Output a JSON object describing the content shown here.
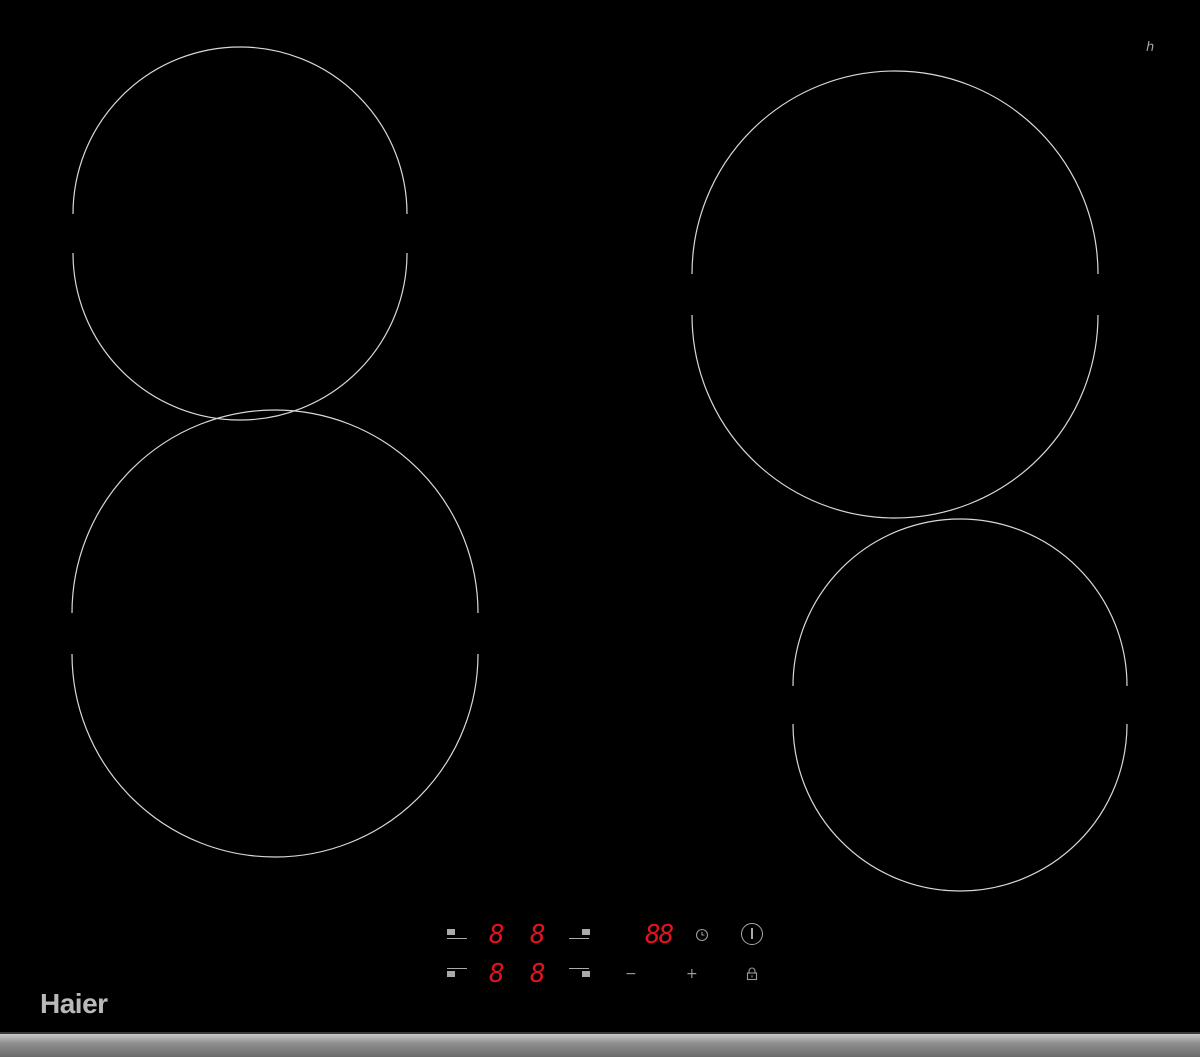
{
  "brand": {
    "name": "Haier"
  },
  "displays": {
    "zone_left_top": "8",
    "zone_right_top": "8",
    "zone_left_bottom": "8",
    "zone_right_bottom": "8",
    "timer": "88"
  },
  "controls": {
    "minus": "−",
    "plus": "+",
    "timer_icon": "clock-icon",
    "lock_icon": "lock-icon",
    "power_icon": "power-icon"
  },
  "colors": {
    "glass": "#000000",
    "zone_ring": "#d8d8d8",
    "display": "#e0141e",
    "symbols": "#9a9a9a",
    "brand": "#b9b9b9"
  }
}
